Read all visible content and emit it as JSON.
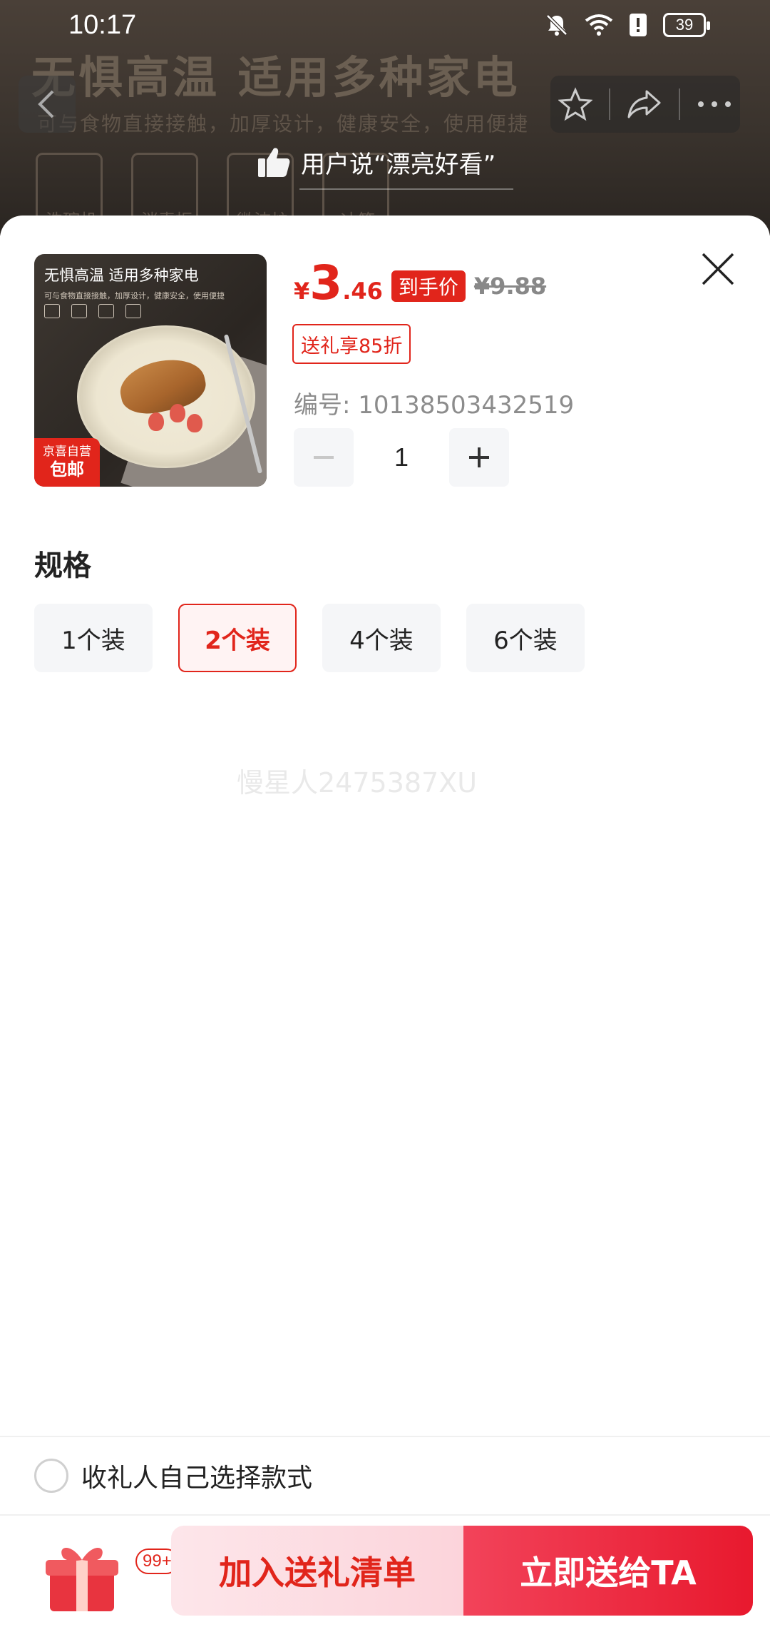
{
  "status_bar": {
    "time": "10:17",
    "battery": "39"
  },
  "background": {
    "headline": "无惧高温 适用多种家电",
    "subline": "可与食物直接接触，加厚设计，健康安全，使用便捷",
    "appliances": [
      "洗碗机",
      "消毒柜",
      "微波炉",
      "冰箱"
    ],
    "user_says": "用户说“漂亮好看”"
  },
  "product": {
    "thumb_title": "无惧高温 适用多种家电",
    "thumb_sub": "可与食物直接接触，加厚设计，健康安全，使用便捷",
    "thumb_badge_top": "京喜自营",
    "thumb_badge_bottom": "包邮",
    "price_yen": "¥",
    "price_int": "3",
    "price_dec": ".46",
    "price_tag": "到手价",
    "price_original": "¥9.88",
    "gift_discount": "送礼享85折",
    "sku": "编号: 10138503432519",
    "quantity": "1"
  },
  "spec": {
    "title": "规格",
    "options": [
      "1个装",
      "2个装",
      "4个装",
      "6个装"
    ],
    "selected_index": 1
  },
  "watermark": "慢星人2475387XU",
  "self_select_label": "收礼人自己选择款式",
  "bottom": {
    "gift_count": "99+",
    "add_label": "加入送礼清单",
    "send_label": "立即送给TA"
  },
  "colors": {
    "accent": "#e1251b"
  }
}
